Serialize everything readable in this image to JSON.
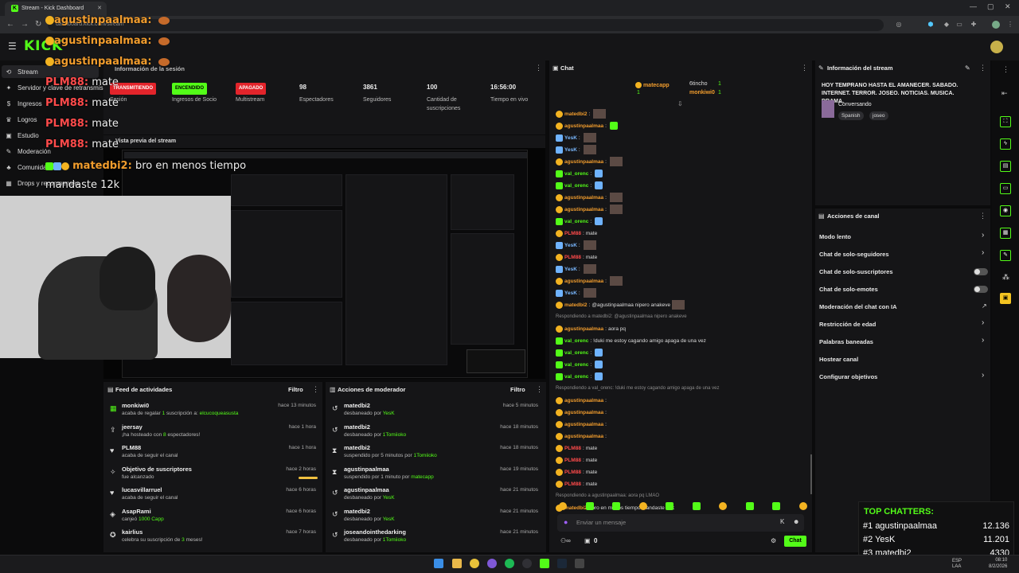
{
  "browser": {
    "tab_title": "Stream - Kick Dashboard",
    "url": "dashboard.kick.com/stream"
  },
  "sidebar": {
    "items": [
      {
        "label": "Stream",
        "icon": "stream-icon",
        "active": true
      },
      {
        "label": "Servidor y clave de retransmisión",
        "icon": "key-icon"
      },
      {
        "label": "Ingresos",
        "icon": "money-icon"
      },
      {
        "label": "Logros",
        "icon": "trophy-icon"
      },
      {
        "label": "Estudio",
        "icon": "studio-icon"
      },
      {
        "label": "Moderación",
        "icon": "wrench-icon"
      },
      {
        "label": "Comunidad",
        "icon": "community-icon"
      },
      {
        "label": "Drops y recompensas",
        "icon": "gift-icon"
      }
    ]
  },
  "stats": {
    "title": "Información de la sesión",
    "items": [
      {
        "badge": "TRANSMITIENDO",
        "badge_style": "red",
        "label": "Sesión"
      },
      {
        "badge": "ENCENDIDO",
        "badge_style": "green",
        "label": "Ingresos de Socio"
      },
      {
        "badge": "APAGADO",
        "badge_style": "red",
        "label": "Multistream"
      },
      {
        "value": "98",
        "label": "Espectadores"
      },
      {
        "value": "3861",
        "label": "Seguidores"
      },
      {
        "value": "100",
        "label": "Cantidad de suscripciones"
      },
      {
        "value": "16:56:00",
        "label": "Tiempo en vivo"
      }
    ]
  },
  "preview": {
    "title": "Vista previa del stream"
  },
  "activity_feed": {
    "title": "Feed de actividades",
    "filter": "Filtro",
    "rows": [
      {
        "icon": "gift-icon",
        "name": "monkiwi0",
        "desc_pre": "acaba de regalar ",
        "desc_num": "1",
        "desc_mid": " suscripción a: ",
        "desc_hl": "elcucoqueasusta",
        "time": "hace 13 minutos"
      },
      {
        "icon": "host-icon",
        "name": "jeersay",
        "desc_pre": "¡ha hosteado con ",
        "desc_num": "8",
        "desc_mid": " espectadores!",
        "desc_hl": "",
        "time": "hace 1 hora"
      },
      {
        "icon": "heart-icon",
        "name": "PLM88",
        "desc_pre": "acaba de seguir el canal",
        "desc_num": "",
        "desc_mid": "",
        "desc_hl": "",
        "time": "hace 1 hora"
      },
      {
        "icon": "target-icon",
        "name": "Objetivo de suscriptores",
        "desc_pre": "fue alcanzado",
        "desc_num": "",
        "desc_mid": "",
        "desc_hl": "",
        "time": "hace 2 horas"
      },
      {
        "icon": "heart-icon",
        "name": "lucasvillarruel",
        "desc_pre": "acaba de seguir el canal",
        "desc_num": "",
        "desc_mid": "",
        "desc_hl": "",
        "time": "hace 6 horas"
      },
      {
        "icon": "redeem-icon",
        "name": "AsapRami",
        "desc_pre": "canjeó ",
        "desc_num": "1000 Capp",
        "desc_mid": "",
        "desc_hl": "",
        "time": "hace 6 horas"
      },
      {
        "icon": "star-icon",
        "name": "kairlius",
        "desc_pre": "celebra su suscripción de ",
        "desc_num": "3",
        "desc_mid": " meses!",
        "desc_hl": "",
        "time": "hace 7 horas"
      }
    ]
  },
  "mod_actions": {
    "title": "Acciones de moderador",
    "filter": "Filtro",
    "rows": [
      {
        "icon": "undo-icon",
        "name": "matedbi2",
        "desc": "desbaneado por ",
        "by": "YesK",
        "time": "hace 5 minutos"
      },
      {
        "icon": "undo-icon",
        "name": "matedbi2",
        "desc": "desbaneado por ",
        "by": "1Tomiioko",
        "time": "hace 18 minutos"
      },
      {
        "icon": "hourglass-icon",
        "name": "matedbi2",
        "desc": "suspendido por 5 minutos por ",
        "by": "1Tomiioko",
        "time": "hace 18 minutos"
      },
      {
        "icon": "hourglass-icon",
        "name": "agustinpaalmaa",
        "desc": "suspendido por 1 minuto por ",
        "by": "matecapp",
        "time": "hace 19 minutos"
      },
      {
        "icon": "undo-icon",
        "name": "agustinpaalmaa",
        "desc": "desbaneado por ",
        "by": "YesK",
        "time": "hace 21 minutos"
      },
      {
        "icon": "undo-icon",
        "name": "matedbi2",
        "desc": "desbaneado por ",
        "by": "YesK",
        "time": "hace 21 minutos"
      },
      {
        "icon": "undo-icon",
        "name": "joseandointhedarking",
        "desc": "desbaneado por ",
        "by": "1Tomiioko",
        "time": "hace 21 minutos"
      }
    ]
  },
  "chat": {
    "title": "Chat",
    "pinned": [
      {
        "name": "matecapp",
        "count": "1"
      },
      {
        "name": "6tincho",
        "count": "1"
      },
      {
        "name": "monkiwi0",
        "count": "1"
      }
    ],
    "lines": [
      {
        "user": "matedbi2",
        "cls": "u-or",
        "text": "",
        "emote": "pic"
      },
      {
        "user": "agustinpaalmaa",
        "cls": "u-or",
        "text": "",
        "emote": "g2"
      },
      {
        "user": "YesK",
        "cls": "u-bl",
        "text": "",
        "emote": "pic"
      },
      {
        "user": "YesK",
        "cls": "u-bl",
        "text": "",
        "emote": "pic"
      },
      {
        "user": "agustinpaalmaa",
        "cls": "u-or",
        "text": "",
        "emote": "pic"
      },
      {
        "user": "val_orenc",
        "cls": "u-gr",
        "text": "",
        "emote": "b"
      },
      {
        "user": "val_orenc",
        "cls": "u-gr",
        "text": "",
        "emote": "b"
      },
      {
        "user": "agustinpaalmaa",
        "cls": "u-or",
        "text": "",
        "emote": "pic"
      },
      {
        "user": "agustinpaalmaa",
        "cls": "u-or",
        "text": "",
        "emote": "pic"
      },
      {
        "user": "val_orenc",
        "cls": "u-gr",
        "text": "",
        "emote": "b"
      },
      {
        "user": "PLM88",
        "cls": "u-red",
        "text": "mate",
        "emote": ""
      },
      {
        "user": "YesK",
        "cls": "u-bl",
        "text": "",
        "emote": "pic"
      },
      {
        "user": "PLM88",
        "cls": "u-red",
        "text": "mate",
        "emote": ""
      },
      {
        "user": "YesK",
        "cls": "u-bl",
        "text": "",
        "emote": "pic"
      },
      {
        "user": "agustinpaalmaa",
        "cls": "u-or",
        "text": "",
        "emote": "pic"
      },
      {
        "user": "YesK",
        "cls": "u-bl",
        "text": "",
        "emote": "pic"
      },
      {
        "user": "matedbi2",
        "cls": "u-or",
        "text": "@agustinpaalmaa nipero anakeve",
        "emote": "pic"
      },
      {
        "reply": "Respondiendo a matedbi2: @agustinpaalmaa nipero anakeve"
      },
      {
        "user": "agustinpaalmaa",
        "cls": "u-or",
        "text": "aora pq",
        "emote": ""
      },
      {
        "user": "val_orenc",
        "cls": "u-gr",
        "text": "!duki me estoy cagando amigo apaga de una vez",
        "emote": ""
      },
      {
        "user": "val_orenc",
        "cls": "u-gr",
        "text": "",
        "emote": "b"
      },
      {
        "user": "val_orenc",
        "cls": "u-gr",
        "text": "",
        "emote": "b"
      },
      {
        "user": "val_orenc",
        "cls": "u-gr",
        "text": "",
        "emote": "b"
      },
      {
        "reply": "Respondiendo a val_orenc: !duki me estoy cagando amigo apaga de una vez"
      },
      {
        "user": "agustinpaalmaa",
        "cls": "u-or",
        "text": "",
        "emote": ""
      },
      {
        "user": "agustinpaalmaa",
        "cls": "u-or",
        "text": "",
        "emote": ""
      },
      {
        "user": "agustinpaalmaa",
        "cls": "u-or",
        "text": "",
        "emote": ""
      },
      {
        "user": "agustinpaalmaa",
        "cls": "u-or",
        "text": "",
        "emote": ""
      },
      {
        "user": "PLM88",
        "cls": "u-red",
        "text": "mate",
        "emote": ""
      },
      {
        "user": "PLM88",
        "cls": "u-red",
        "text": "mate",
        "emote": ""
      },
      {
        "user": "PLM88",
        "cls": "u-red",
        "text": "mate",
        "emote": ""
      },
      {
        "user": "PLM88",
        "cls": "u-red",
        "text": "mate",
        "emote": ""
      },
      {
        "reply": "Respondiendo a agustinpaalmaa: aora pq LMAO"
      },
      {
        "user": "matedbi2",
        "cls": "u-or",
        "text": "bro en menos tiempo mandaste 12k",
        "emote": ""
      }
    ],
    "input_placeholder": "Enviar un mensaje",
    "viewers_icon": "users-icon",
    "points": "0",
    "send_label": "Chat"
  },
  "stream_info": {
    "title": "Información del stream",
    "description": "HOY TEMPRANO HASTA EL AMANECER. SABADO. INTERNET. TERROR. JOSEO. NOTICIAS. MUSICA. DRAMA.",
    "category": "Conversando",
    "tags": [
      "Spanish",
      "joseo"
    ]
  },
  "channel_actions": {
    "title": "Acciones de canal",
    "items": [
      {
        "label": "Modo lento",
        "control": "chevron"
      },
      {
        "label": "Chat de solo-seguidores",
        "control": "chevron"
      },
      {
        "label": "Chat de solo-suscriptores",
        "control": "toggle"
      },
      {
        "label": "Chat de solo-emotes",
        "control": "toggle"
      },
      {
        "label": "Moderación del chat con IA",
        "control": "external"
      },
      {
        "label": "Restricción de edad",
        "control": "chevron"
      },
      {
        "label": "Palabras baneadas",
        "control": "chevron"
      },
      {
        "label": "Hostear canal",
        "control": "none"
      },
      {
        "label": "Configurar objetivos",
        "control": "chevron"
      }
    ]
  },
  "overlay": {
    "chat_lines": [
      {
        "name": "agustinpaalmaa:",
        "cls": "ovname"
      },
      {
        "name": "agustinpaalmaa:",
        "cls": "ovname"
      },
      {
        "name": "agustinpaalmaa:",
        "cls": "ovname"
      },
      {
        "name": "PLM88:",
        "cls": "ovplm",
        "text": "mate"
      },
      {
        "name": "PLM88:",
        "cls": "ovplm",
        "text": "mate"
      },
      {
        "name": "PLM88:",
        "cls": "ovplm",
        "text": "mate"
      },
      {
        "name": "PLM88:",
        "cls": "ovplm",
        "text": "mate"
      }
    ],
    "last_name": "matedbi2:",
    "last_text": "bro en menos tiempo",
    "last_text2": "mandaste 12k"
  },
  "top_chatters": {
    "title": "TOP CHATTERS:",
    "rows": [
      {
        "rank": "#1",
        "name": "agustinpaalmaa",
        "count": "12.136"
      },
      {
        "rank": "#2",
        "name": "YesK",
        "count": "11.201"
      },
      {
        "rank": "#3",
        "name": "matedbi2",
        "count": "4330"
      }
    ]
  },
  "taskbar": {
    "lang": "ESP\nLAA",
    "time": "08:10",
    "date": "8/2/2026"
  },
  "colors": {
    "accent": "#53fc18",
    "danger": "#e3242b",
    "panel": "#151517"
  }
}
